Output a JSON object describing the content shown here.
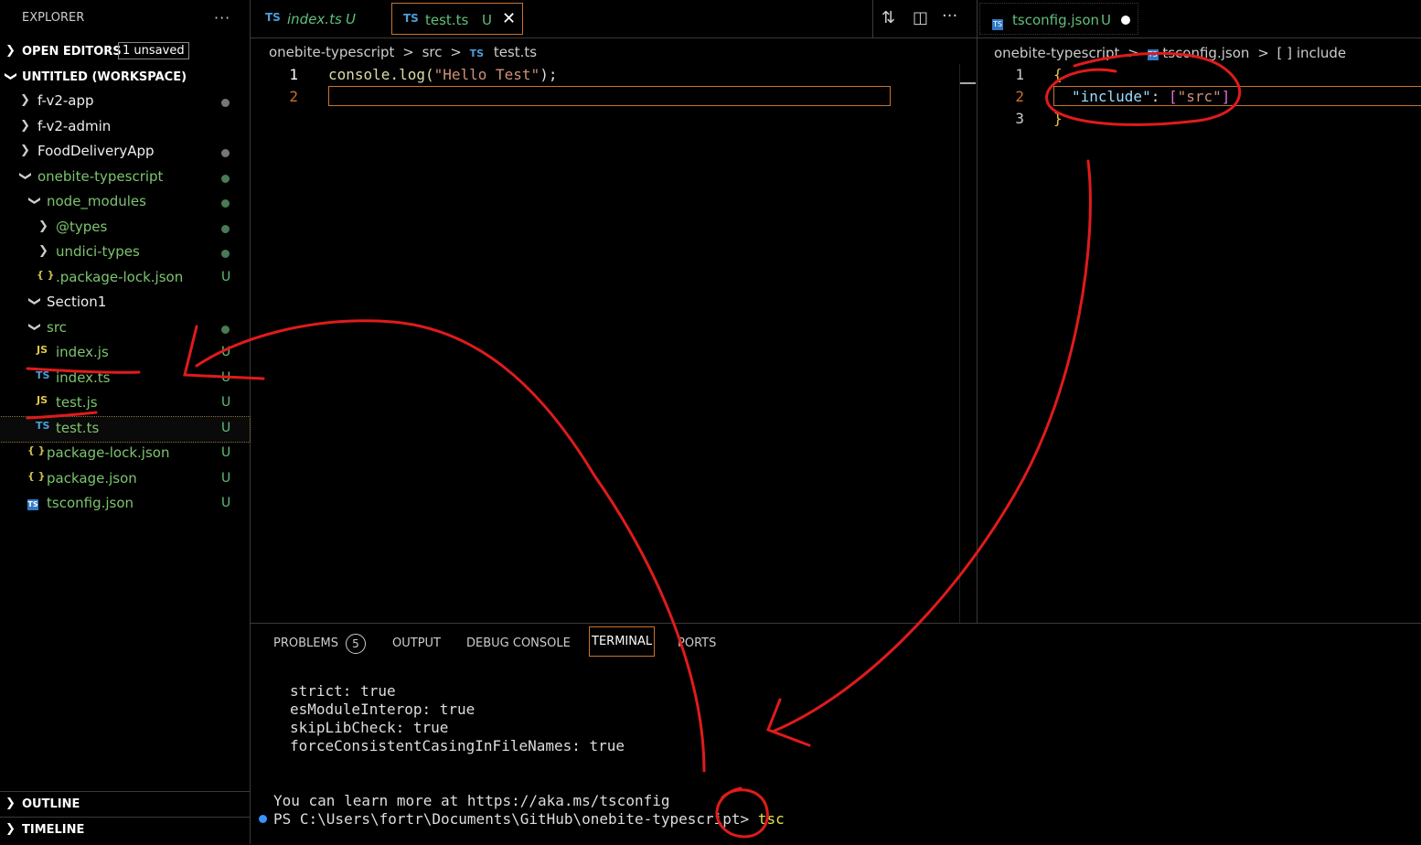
{
  "explorer": {
    "title": "EXPLORER",
    "more": "···",
    "open_editors": {
      "label": "OPEN EDITORS",
      "badge": "1 unsaved"
    },
    "workspace": {
      "label": "UNTITLED (WORKSPACE)"
    },
    "tree": [
      {
        "name": "f-v2-app",
        "status": "dot"
      },
      {
        "name": "f-v2-admin",
        "status": ""
      },
      {
        "name": "FoodDeliveryApp",
        "status": "dot"
      },
      {
        "name": "onebite-typescript",
        "status": "dot"
      },
      {
        "name": "node_modules",
        "status": "dot"
      },
      {
        "name": "@types",
        "status": "dot"
      },
      {
        "name": "undici-types",
        "status": "dot"
      },
      {
        "name": ".package-lock.json",
        "icon": "{ }",
        "status": "U"
      },
      {
        "name": "Section1",
        "status": ""
      },
      {
        "name": "src",
        "status": "dot"
      },
      {
        "name": "index.js",
        "icon": "JS",
        "status": "U"
      },
      {
        "name": "index.ts",
        "icon": "TS",
        "status": "U"
      },
      {
        "name": "test.js",
        "icon": "JS",
        "status": "U"
      },
      {
        "name": "test.ts",
        "icon": "TS",
        "status": "U"
      },
      {
        "name": "package-lock.json",
        "icon": "{ }",
        "status": "U"
      },
      {
        "name": "package.json",
        "icon": "{ }",
        "status": "U"
      },
      {
        "name": "tsconfig.json",
        "icon": "TS",
        "status": "U"
      }
    ],
    "outline": "OUTLINE",
    "timeline": "TIMELINE"
  },
  "left_group": {
    "tabs": [
      {
        "icon": "TS",
        "label": "index.ts",
        "status": "U"
      },
      {
        "icon": "TS",
        "label": "test.ts",
        "status": "U",
        "close": "✕"
      }
    ],
    "breadcrumb": {
      "root": "onebite-typescript",
      "sep": ">",
      "folder": "src",
      "icon": "TS",
      "file": "test.ts"
    },
    "line_numbers": [
      "1",
      "2"
    ],
    "code": {
      "fn": "console.log(",
      "str": "\"Hello Test\"",
      "end": ");"
    }
  },
  "right_group": {
    "tab": {
      "icon": "TS",
      "label": "tsconfig.json",
      "status": "U"
    },
    "breadcrumb": {
      "root": "onebite-typescript",
      "sep": ">",
      "icon": "TS",
      "file": "tsconfig.json",
      "sym": "[ ]",
      "symbol": "include"
    },
    "line_numbers": [
      "1",
      "2",
      "3"
    ],
    "code": {
      "open": "{",
      "key": "\"include\"",
      "colon": ": ",
      "br_open": "[",
      "val": "\"src\"",
      "br_close": "]",
      "close": "}"
    }
  },
  "panel": {
    "tabs": [
      "PROBLEMS",
      "OUTPUT",
      "DEBUG CONSOLE",
      "TERMINAL",
      "PORTS"
    ],
    "problems_count": "5",
    "terminal_lines": [
      "strict: true",
      "esModuleInterop: true",
      "skipLibCheck: true",
      "forceConsistentCasingInFileNames: true"
    ],
    "learn_more": "You can learn more at https://aka.ms/tsconfig",
    "prompt": "PS C:\\Users\\fortr\\Documents\\GitHub\\onebite-typescript>",
    "command": "tsc"
  },
  "colors": {
    "accent": "#c8732c",
    "git_untracked": "#5fbf7a",
    "annotation": "#e01b1b",
    "terminal_dot": "#3794ff"
  }
}
